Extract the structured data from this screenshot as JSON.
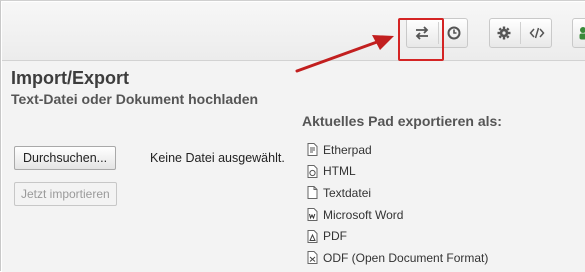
{
  "toolbar": {
    "buttons": [
      {
        "name": "import-export-icon",
        "glyph": "⇄"
      },
      {
        "name": "history-clock-icon",
        "glyph": "◷"
      },
      {
        "name": "settings-gear-icon",
        "glyph": "⚙"
      },
      {
        "name": "embed-code-icon",
        "glyph": "</>"
      },
      {
        "name": "users-icon",
        "glyph": "users"
      }
    ]
  },
  "panel": {
    "title": "Import/Export",
    "subtitle": "Text-Datei oder Dokument hochladen",
    "browse_label": "Durchsuchen...",
    "file_status": "Keine Datei ausgewählt.",
    "import_label": "Jetzt importieren",
    "export_title": "Aktuelles Pad exportieren als:",
    "export_items": [
      {
        "label": "Etherpad",
        "icon": "etherpad-file-icon"
      },
      {
        "label": "HTML",
        "icon": "html-file-icon"
      },
      {
        "label": "Textdatei",
        "icon": "text-file-icon"
      },
      {
        "label": "Microsoft Word",
        "icon": "word-file-icon"
      },
      {
        "label": "PDF",
        "icon": "pdf-file-icon"
      },
      {
        "label": "ODF (Open Document Format)",
        "icon": "odf-file-icon"
      }
    ]
  },
  "colors": {
    "highlight": "#d42424",
    "toolbar_bg": "#efefef",
    "panel_bg": "#f3f3f3"
  }
}
